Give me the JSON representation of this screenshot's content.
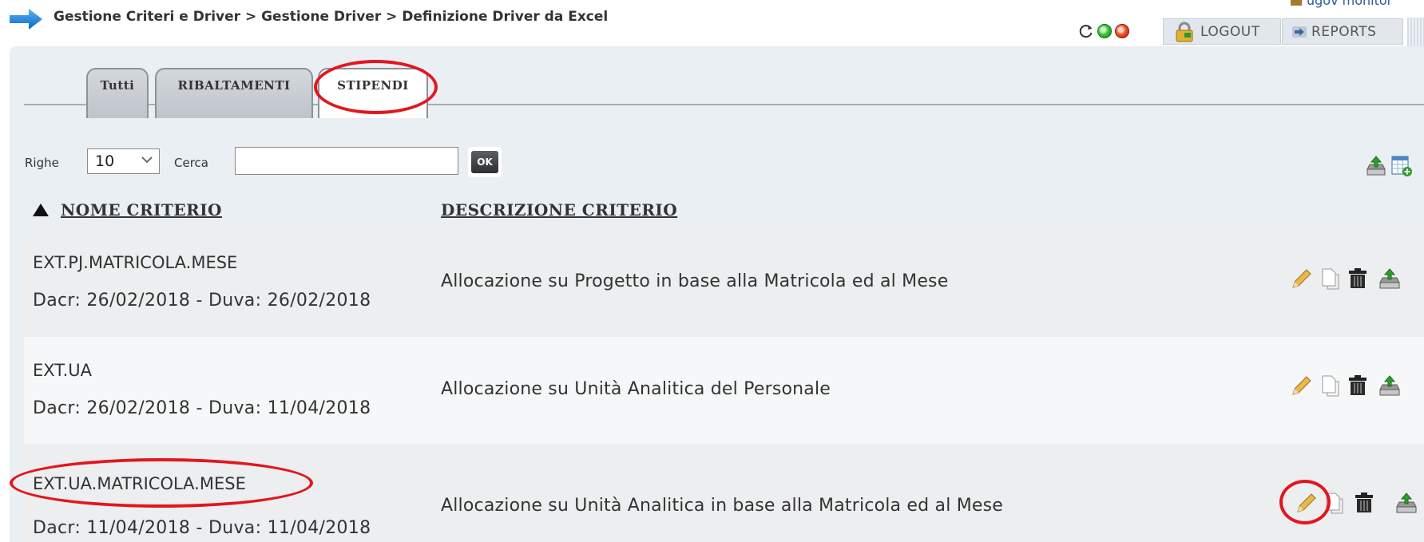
{
  "header": {
    "breadcrumb": "Gestione Criteri e Driver > Gestione Driver > Definizione Driver da Excel",
    "user_link": "ugov monitor",
    "logout_label": "LOGOUT",
    "reports_label": "REPORTS"
  },
  "tabs": [
    {
      "label": "Tutti",
      "active": false
    },
    {
      "label": "RIBALTAMENTI",
      "active": false
    },
    {
      "label": "STIPENDI",
      "active": true
    }
  ],
  "search": {
    "righe_label": "Righe",
    "righe_value": "10",
    "cerca_label": "Cerca",
    "cerca_value": "",
    "ok_label": "OK"
  },
  "table": {
    "sort_indicator": "▲",
    "columns": [
      "NOME CRITERIO",
      "DESCRIZIONE CRITERIO"
    ],
    "rows": [
      {
        "name": "EXT.PJ.MATRICOLA.MESE",
        "dates": "Dacr: 26/02/2018 - Duva: 26/02/2018",
        "description": "Allocazione su Progetto in base alla Matricola ed al Mese"
      },
      {
        "name": "EXT.UA",
        "dates": "Dacr: 26/02/2018 - Duva: 11/04/2018",
        "description": "Allocazione su Unità Analitica del Personale"
      },
      {
        "name": "EXT.UA.MATRICOLA.MESE",
        "dates": "Dacr: 11/04/2018 - Duva: 11/04/2018",
        "description": "Allocazione su Unità Analitica in base alla Matricola ed al Mese"
      }
    ]
  },
  "icons": {
    "header": [
      "arrow-right-icon",
      "refresh-icon",
      "green-status-icon",
      "red-status-icon",
      "lock-icon",
      "arrow-icon"
    ],
    "toolbar": [
      "import-icon",
      "new-sheet-icon"
    ],
    "row_actions": [
      "edit-pencil-icon",
      "copy-icon",
      "trash-icon",
      "download-icon"
    ]
  },
  "colors": {
    "panel_bg": "#eaeff4",
    "annotation_red": "#e3161d",
    "brand_blue": "#1e7fd6"
  }
}
